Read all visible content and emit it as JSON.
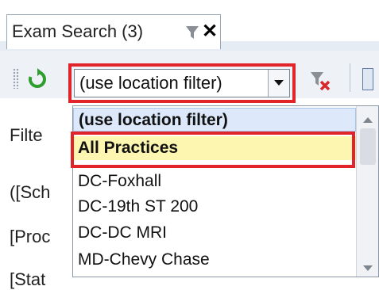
{
  "tab": {
    "label": "Exam Search (3)",
    "icons": [
      "filter-icon",
      "close-icon"
    ]
  },
  "toolbar": {
    "location_filter_value": "(use location filter)",
    "icons": [
      "refresh-icon",
      "chevron-down-icon",
      "clear-filter-icon"
    ]
  },
  "side_labels": [
    "Filte",
    "([Sch",
    "[Proc",
    "[Stat"
  ],
  "dropdown": {
    "items": [
      "(use location filter)",
      "All Practices",
      "DC-Foxhall",
      "DC-19th ST 200",
      "DC-DC MRI",
      "MD-Chevy Chase"
    ],
    "selected": "All Practices"
  },
  "colors": {
    "highlight_red": "#e0242a",
    "selected_yellow": "#fdf6b0",
    "current_blue": "#dde9fb",
    "refresh_green": "#2f9e2f"
  }
}
